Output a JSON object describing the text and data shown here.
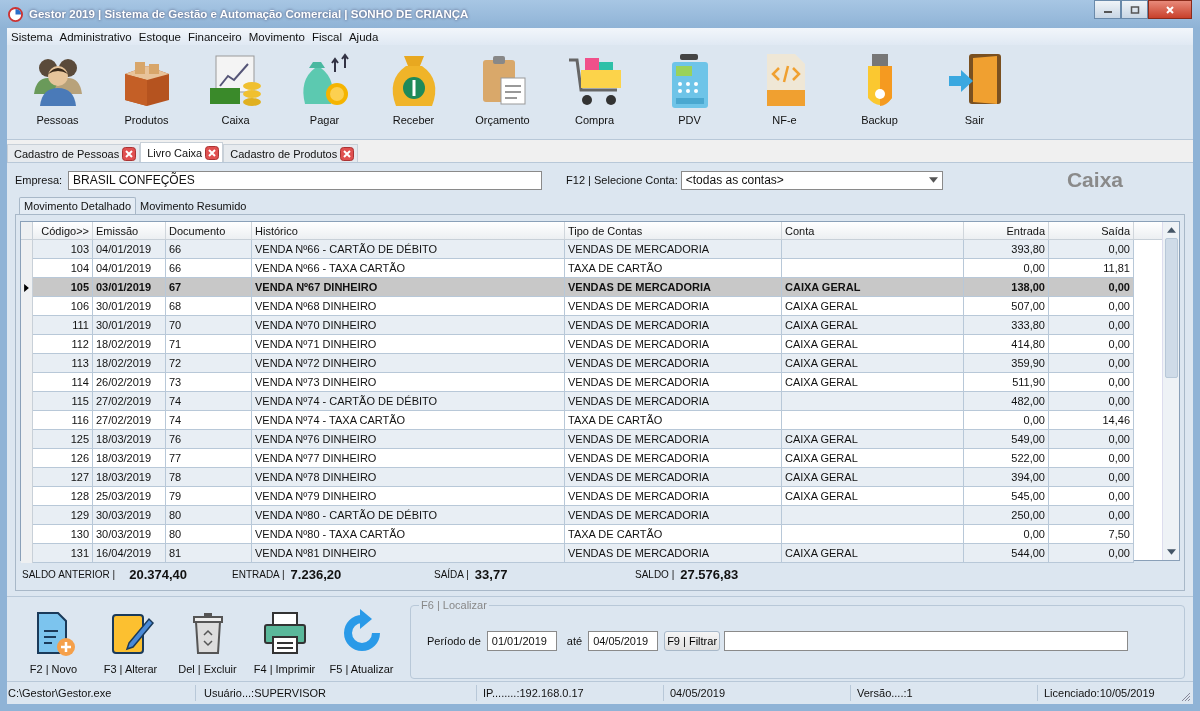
{
  "window": {
    "title": "Gestor 2019 | Sistema de Gestão e Automação Comercial | SONHO DE CRIANÇA"
  },
  "menu": [
    "Sistema",
    "Administrativo",
    "Estoque",
    "Financeiro",
    "Movimento",
    "Fiscal",
    "Ajuda"
  ],
  "toolbar": [
    {
      "label": "Pessoas"
    },
    {
      "label": "Produtos"
    },
    {
      "label": "Caixa"
    },
    {
      "label": "Pagar"
    },
    {
      "label": "Receber"
    },
    {
      "label": "Orçamento"
    },
    {
      "label": "Compra"
    },
    {
      "label": "PDV"
    },
    {
      "label": "NF-e"
    },
    {
      "label": "Backup"
    },
    {
      "label": "Sair"
    }
  ],
  "document_tabs": [
    {
      "label": "Cadastro de Pessoas",
      "selected": false
    },
    {
      "label": "Livro Caixa",
      "selected": true
    },
    {
      "label": "Cadastro de Produtos",
      "selected": false
    }
  ],
  "empresa": {
    "label": "Empresa:",
    "value": "BRASIL CONFEÇÕES"
  },
  "conta": {
    "label": "F12 | Selecione Conta:",
    "value": "<todas as contas>"
  },
  "heading": "Caixa",
  "view_tabs": [
    {
      "label": "Movimento Detalhado",
      "selected": true
    },
    {
      "label": "Movimento Resumido",
      "selected": false
    }
  ],
  "table": {
    "columns": [
      "Código>>",
      "Emissão",
      "Documento",
      "Histórico",
      "Tipo de Contas",
      "Conta",
      "Entrada",
      "Saída"
    ],
    "rows": [
      {
        "selected": false,
        "cells": [
          "103",
          "04/01/2019",
          "66",
          "VENDA Nº66 - CARTÃO DE DÉBITO",
          "VENDAS DE MERCADORIA",
          "",
          "393,80",
          "0,00"
        ]
      },
      {
        "selected": false,
        "cells": [
          "104",
          "04/01/2019",
          "66",
          "VENDA Nº66 - TAXA CARTÃO",
          "TAXA DE CARTÃO",
          "",
          "0,00",
          "11,81"
        ]
      },
      {
        "selected": true,
        "cells": [
          "105",
          "03/01/2019",
          "67",
          "VENDA Nº67 DINHEIRO",
          "VENDAS DE MERCADORIA",
          "CAIXA GERAL",
          "138,00",
          "0,00"
        ]
      },
      {
        "selected": false,
        "cells": [
          "106",
          "30/01/2019",
          "68",
          "VENDA Nº68 DINHEIRO",
          "VENDAS DE MERCADORIA",
          "CAIXA GERAL",
          "507,00",
          "0,00"
        ]
      },
      {
        "selected": false,
        "cells": [
          "111",
          "30/01/2019",
          "70",
          "VENDA Nº70 DINHEIRO",
          "VENDAS DE MERCADORIA",
          "CAIXA GERAL",
          "333,80",
          "0,00"
        ]
      },
      {
        "selected": false,
        "cells": [
          "112",
          "18/02/2019",
          "71",
          "VENDA Nº71 DINHEIRO",
          "VENDAS DE MERCADORIA",
          "CAIXA GERAL",
          "414,80",
          "0,00"
        ]
      },
      {
        "selected": false,
        "cells": [
          "113",
          "18/02/2019",
          "72",
          "VENDA Nº72 DINHEIRO",
          "VENDAS DE MERCADORIA",
          "CAIXA GERAL",
          "359,90",
          "0,00"
        ]
      },
      {
        "selected": false,
        "cells": [
          "114",
          "26/02/2019",
          "73",
          "VENDA Nº73 DINHEIRO",
          "VENDAS DE MERCADORIA",
          "CAIXA GERAL",
          "511,90",
          "0,00"
        ]
      },
      {
        "selected": false,
        "cells": [
          "115",
          "27/02/2019",
          "74",
          "VENDA Nº74 - CARTÃO DE DÉBITO",
          "VENDAS DE MERCADORIA",
          "",
          "482,00",
          "0,00"
        ]
      },
      {
        "selected": false,
        "cells": [
          "116",
          "27/02/2019",
          "74",
          "VENDA Nº74 - TAXA CARTÃO",
          "TAXA DE CARTÃO",
          "",
          "0,00",
          "14,46"
        ]
      },
      {
        "selected": false,
        "cells": [
          "125",
          "18/03/2019",
          "76",
          "VENDA Nº76 DINHEIRO",
          "VENDAS DE MERCADORIA",
          "CAIXA GERAL",
          "549,00",
          "0,00"
        ]
      },
      {
        "selected": false,
        "cells": [
          "126",
          "18/03/2019",
          "77",
          "VENDA Nº77 DINHEIRO",
          "VENDAS DE MERCADORIA",
          "CAIXA GERAL",
          "522,00",
          "0,00"
        ]
      },
      {
        "selected": false,
        "cells": [
          "127",
          "18/03/2019",
          "78",
          "VENDA Nº78 DINHEIRO",
          "VENDAS DE MERCADORIA",
          "CAIXA GERAL",
          "394,00",
          "0,00"
        ]
      },
      {
        "selected": false,
        "cells": [
          "128",
          "25/03/2019",
          "79",
          "VENDA Nº79 DINHEIRO",
          "VENDAS DE MERCADORIA",
          "CAIXA GERAL",
          "545,00",
          "0,00"
        ]
      },
      {
        "selected": false,
        "cells": [
          "129",
          "30/03/2019",
          "80",
          "VENDA Nº80 - CARTÃO DE DÉBITO",
          "VENDAS DE MERCADORIA",
          "",
          "250,00",
          "0,00"
        ]
      },
      {
        "selected": false,
        "cells": [
          "130",
          "30/03/2019",
          "80",
          "VENDA Nº80 - TAXA CARTÃO",
          "TAXA DE CARTÃO",
          "",
          "0,00",
          "7,50"
        ]
      },
      {
        "selected": false,
        "cells": [
          "131",
          "16/04/2019",
          "81",
          "VENDA Nº81 DINHEIRO",
          "VENDAS DE MERCADORIA",
          "CAIXA GERAL",
          "544,00",
          "0,00"
        ]
      }
    ]
  },
  "totals": [
    {
      "label": "SALDO ANTERIOR |",
      "value": "20.374,40"
    },
    {
      "label": "ENTRADA |",
      "value": "7.236,20"
    },
    {
      "label": "SAÍDA |",
      "value": "33,77"
    },
    {
      "label": "SALDO |",
      "value": "27.576,83"
    }
  ],
  "actions": [
    {
      "label": "F2 | Novo"
    },
    {
      "label": "F3 | Alterar"
    },
    {
      "label": "Del | Excluir"
    },
    {
      "label": "F4 | Imprimir"
    },
    {
      "label": "F5 | Atualizar"
    }
  ],
  "filter": {
    "legend": "F6 | Localizar",
    "from_label": "Período de",
    "from": "01/01/2019",
    "to_label": "até",
    "to": "04/05/2019",
    "button": "F9 | Filtrar"
  },
  "status_bar": [
    "C:\\Gestor\\Gestor.exe",
    "Usuário...:SUPERVISOR",
    "IP........:192.168.0.17",
    "04/05/2019",
    "Versão....:1",
    "Licenciado:10/05/2019"
  ]
}
